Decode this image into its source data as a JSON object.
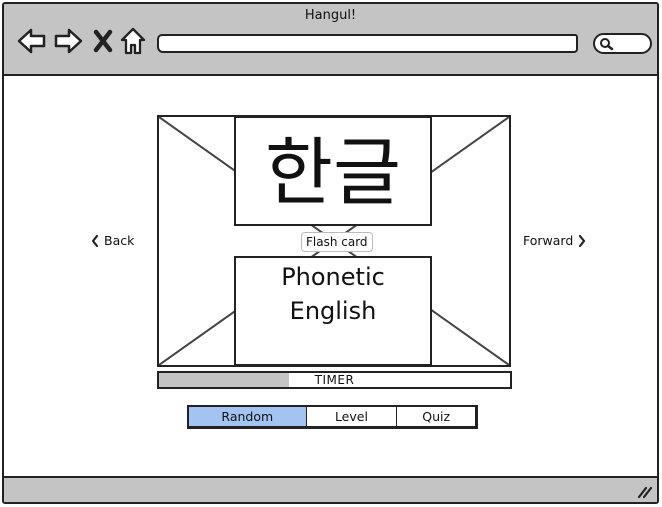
{
  "window": {
    "title": "Hangul!"
  },
  "toolbar": {
    "back_icon": "arrow-left-icon",
    "forward_icon": "arrow-right-icon",
    "stop_icon": "close-icon",
    "home_icon": "home-icon",
    "url": "",
    "search_icon": "search-icon"
  },
  "flashcard": {
    "korean": "한글",
    "label": "Flash card",
    "phonetic": "Phonetic",
    "english": "English"
  },
  "navigation": {
    "back_label": "Back",
    "forward_label": "Forward"
  },
  "timer": {
    "label": "TIMER",
    "progress": 0.37
  },
  "modes": {
    "items": [
      {
        "label": "Random",
        "active": true
      },
      {
        "label": "Level",
        "active": false
      },
      {
        "label": "Quiz",
        "active": false
      }
    ]
  },
  "colors": {
    "chrome": "#c4c4c4",
    "selected": "#a3c4f2",
    "outline": "#222222"
  }
}
